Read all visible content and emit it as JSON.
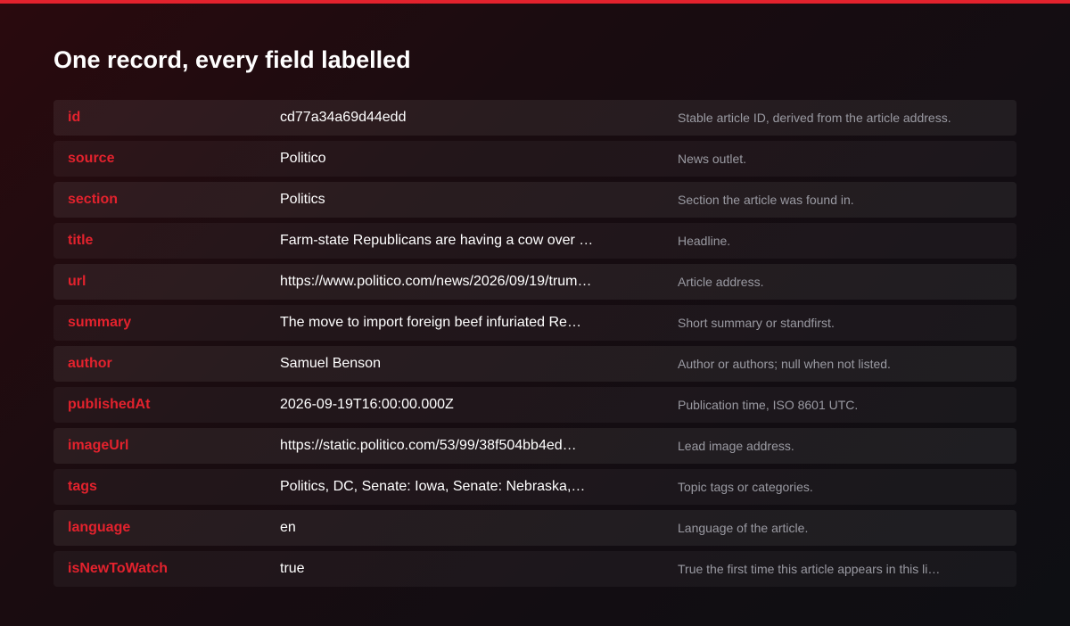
{
  "page": {
    "title": "One record, every field labelled"
  },
  "colors": {
    "accent": "#e3222d",
    "background": "#1a0c10",
    "value_text": "#ffffff",
    "description_text": "#9a9aa2"
  },
  "fields": [
    {
      "name": "id",
      "value": "cd77a34a69d44edd",
      "description": "Stable article ID, derived from the article address."
    },
    {
      "name": "source",
      "value": "Politico",
      "description": "News outlet."
    },
    {
      "name": "section",
      "value": "Politics",
      "description": "Section the article was found in."
    },
    {
      "name": "title",
      "value": "Farm-state Republicans are having a cow over …",
      "description": "Headline."
    },
    {
      "name": "url",
      "value": "https://www.politico.com/news/2026/09/19/trum…",
      "description": "Article address."
    },
    {
      "name": "summary",
      "value": "The move to import foreign beef infuriated Re…",
      "description": "Short summary or standfirst."
    },
    {
      "name": "author",
      "value": "Samuel Benson",
      "description": "Author or authors; null when not listed."
    },
    {
      "name": "publishedAt",
      "value": "2026-09-19T16:00:00.000Z",
      "description": "Publication time, ISO 8601 UTC."
    },
    {
      "name": "imageUrl",
      "value": "https://static.politico.com/53/99/38f504bb4ed…",
      "description": "Lead image address."
    },
    {
      "name": "tags",
      "value": "Politics, DC, Senate: Iowa, Senate: Nebraska,…",
      "description": "Topic tags or categories."
    },
    {
      "name": "language",
      "value": "en",
      "description": "Language of the article."
    },
    {
      "name": "isNewToWatch",
      "value": "true",
      "description": "True the first time this article appears in this li…"
    }
  ]
}
